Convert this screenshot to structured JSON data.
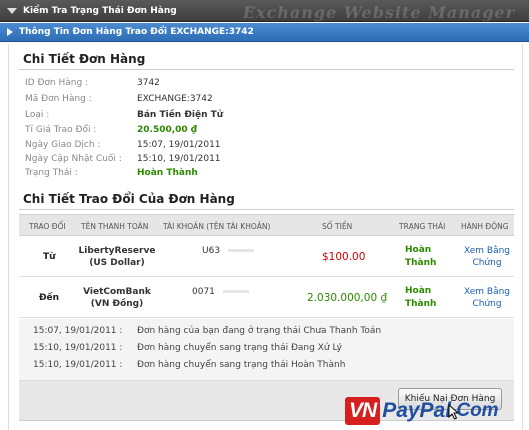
{
  "header": {
    "top_bar": "Kiểm Tra Trạng Thái Đơn Hàng",
    "watermark": "Exchange Website Manager",
    "sub_bar": "Thông Tin Đơn Hàng Trao Đổi EXCHANGE:3742"
  },
  "order": {
    "title": "Chi Tiết Đơn Hàng",
    "fields": [
      {
        "label": "ID Đơn Hàng :",
        "value": "3742"
      },
      {
        "label": "Mã Đơn Hàng :",
        "value": "EXCHANGE:3742"
      },
      {
        "label": "Loại :",
        "value": "Bán Tiền Điện Tử"
      },
      {
        "label": "Tỉ Giá Trao Đổi :",
        "value": "20.500,00 ₫"
      },
      {
        "label": "Ngày Giao Dịch :",
        "value": "15:07, 19/01/2011"
      },
      {
        "label": "Ngày Cập Nhật Cuối :",
        "value": "15:10, 19/01/2011"
      },
      {
        "label": "Trạng Thái :",
        "value": "Hoàn Thành"
      }
    ]
  },
  "exchange": {
    "title": "Chi Tiết Trao Đổi Của Đơn Hàng",
    "columns": [
      "Trao Đổi",
      "Tên Thanh Toán",
      "Tài Khoản (Tên Tài Khoản)",
      "Số Tiền",
      "Trạng Thái",
      "Hành Động"
    ],
    "rows": [
      {
        "direction": "Từ",
        "name_line1": "LibertyReserve",
        "name_line2": "(US Dollar)",
        "account": "U63",
        "amount": "$100.00",
        "status_line1": "Hoàn",
        "status_line2": "Thành",
        "action_line1": "Xem Bằng",
        "action_line2": "Chứng"
      },
      {
        "direction": "Đến",
        "name_line1": "VietComBank",
        "name_line2": "(VN Đồng)",
        "account": "0071",
        "amount": "2.030.000,00 ₫",
        "status_line1": "Hoàn",
        "status_line2": "Thành",
        "action_line1": "Xem Bằng",
        "action_line2": "Chứng"
      }
    ]
  },
  "log": [
    {
      "time": "15:07, 19/01/2011 :",
      "message": "Đơn hàng của bạn đang ở trạng thái Chưa Thanh Toán"
    },
    {
      "time": "15:10, 19/01/2011 :",
      "message": "Đơn hàng chuyển sang trạng thái Đang Xử Lý"
    },
    {
      "time": "15:10, 19/01/2011 :",
      "message": "Đơn hàng chuyển sang trạng thái Hoàn Thành"
    }
  ],
  "actions": {
    "complain_label": "Khiếu Nại Đơn Hàng"
  },
  "logo": {
    "vn": "VN",
    "paypal": "PayPal",
    "com": ".Com"
  },
  "colors": {
    "accent_blue": "#2e6db5",
    "success_green": "#2d8a00",
    "amount_red": "#d00000",
    "logo_red": "#d62020"
  }
}
